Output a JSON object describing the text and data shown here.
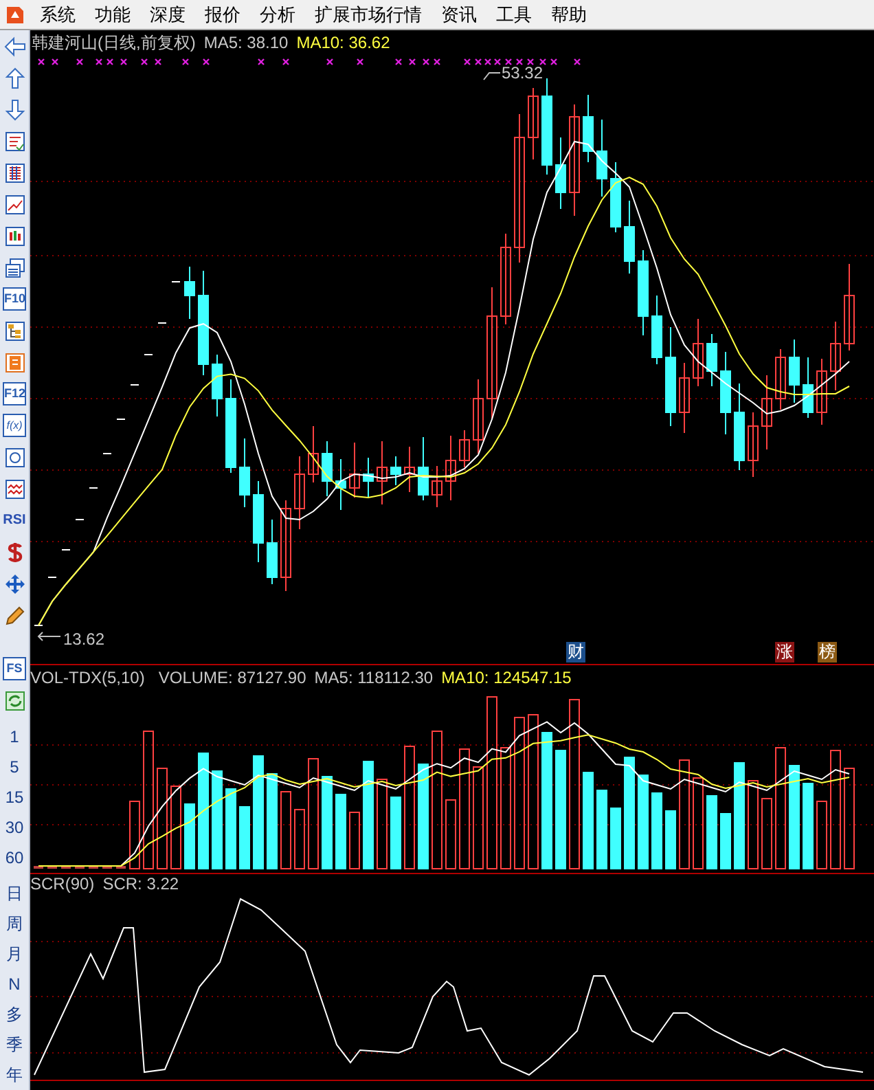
{
  "menu": [
    "系统",
    "功能",
    "深度",
    "报价",
    "分析",
    "扩展市场行情",
    "资讯",
    "工具",
    "帮助"
  ],
  "toolbar": {
    "f10": "F10",
    "f12": "F12",
    "fx": "f(x)",
    "rsi": "RSI",
    "fs": "FS"
  },
  "volume_periods": [
    "1",
    "5",
    "15",
    "30",
    "60"
  ],
  "period_buttons": [
    "日",
    "周",
    "月",
    "N",
    "多",
    "季",
    "年"
  ],
  "main_panel": {
    "stock": "韩建河山(日线,前复权)",
    "ma5": "MA5: 38.10",
    "ma10": "MA10: 36.62",
    "high_label": "53.32",
    "low_label": "13.62",
    "event_tags": [
      {
        "label": "财",
        "color": "#1c4f8c"
      },
      {
        "label": "涨",
        "color": "#8c1414"
      },
      {
        "label": "榜",
        "color": "#8c5a14"
      }
    ]
  },
  "volume_panel": {
    "name": "VOL-TDX(5,10)",
    "volume": "VOLUME: 87127.90",
    "ma5": "MA5: 118112.30",
    "ma10": "MA10: 124547.15"
  },
  "scr_panel": {
    "name": "SCR(90)",
    "value": "SCR: 3.22"
  }
}
